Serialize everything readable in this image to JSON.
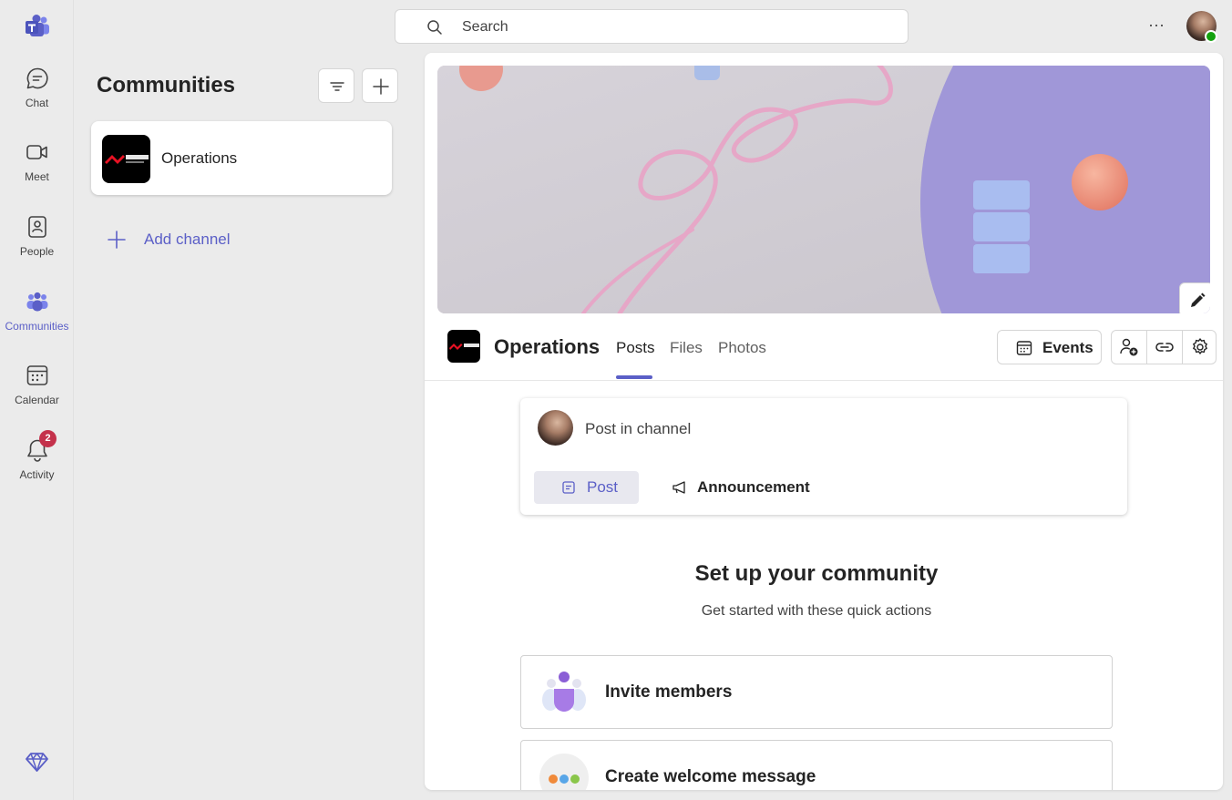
{
  "rail": {
    "items": [
      {
        "label": "Chat",
        "icon": "chat-icon"
      },
      {
        "label": "Meet",
        "icon": "video-icon"
      },
      {
        "label": "People",
        "icon": "people-book-icon"
      },
      {
        "label": "Communities",
        "icon": "communities-icon",
        "active": true
      },
      {
        "label": "Calendar",
        "icon": "calendar-icon"
      },
      {
        "label": "Activity",
        "icon": "bell-icon",
        "badge": "2"
      }
    ]
  },
  "search": {
    "placeholder": "Search"
  },
  "communities": {
    "title": "Communities",
    "items": [
      {
        "name": "Operations"
      }
    ],
    "add_channel": "Add channel"
  },
  "community": {
    "name": "Operations",
    "tabs": [
      "Posts",
      "Files",
      "Photos"
    ],
    "active_tab": "Posts",
    "events_label": "Events"
  },
  "composer": {
    "placeholder": "Post in channel",
    "post_label": "Post",
    "announcement_label": "Announcement"
  },
  "setup": {
    "title": "Set up your community",
    "subtitle": "Get started with these quick actions",
    "actions": [
      "Invite members",
      "Create welcome message"
    ]
  },
  "colors": {
    "accent": "#5b5fc7",
    "badge": "#c4314b",
    "presence": "#13a10e"
  }
}
